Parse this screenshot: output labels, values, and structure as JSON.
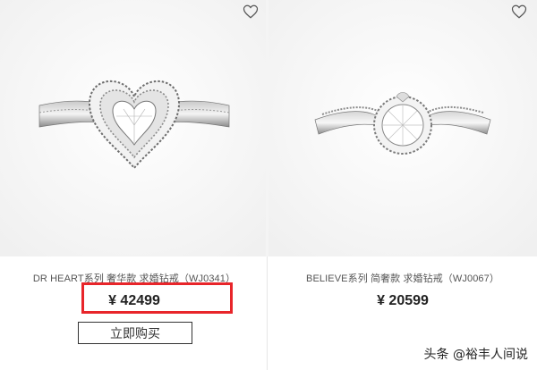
{
  "products": [
    {
      "title": "DR HEART系列 奢华款 求婚钻戒（WJ0341）",
      "price": "¥ 42499",
      "buy_label": "立即购买",
      "favorite_icon": "heart-outline-icon",
      "price_highlighted": true
    },
    {
      "title": "BELIEVE系列 简奢款 求婚钻戒（WJ0067）",
      "price": "¥ 20599",
      "favorite_icon": "heart-outline-icon"
    }
  ],
  "watermark": "头条 @裕丰人间说",
  "colors": {
    "highlight": "#e8252a"
  }
}
